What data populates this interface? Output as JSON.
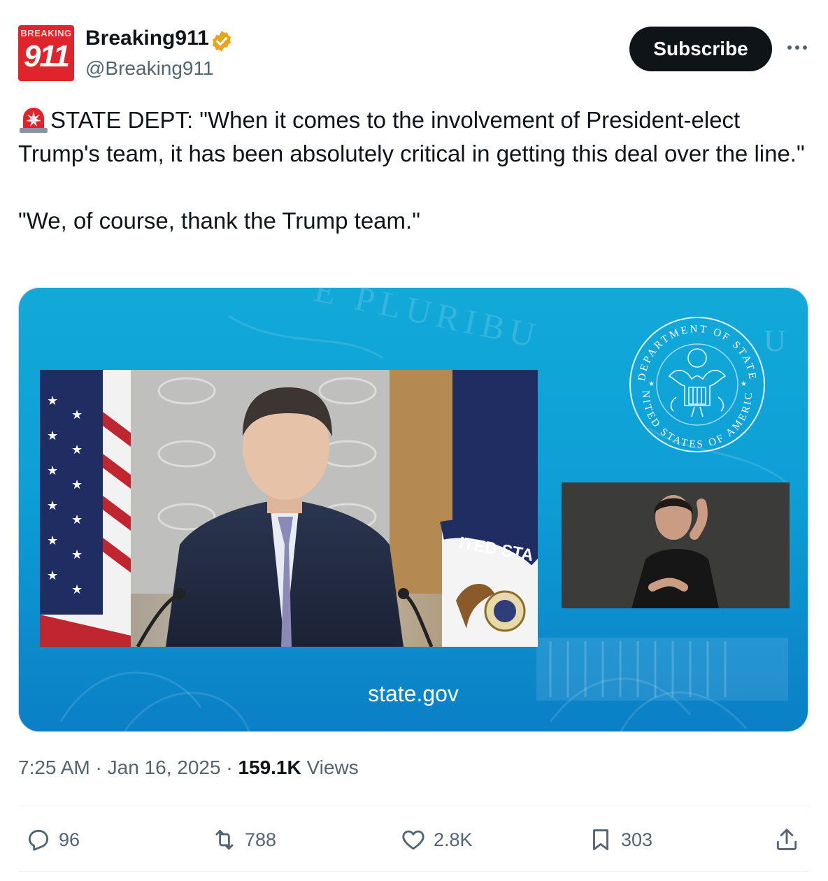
{
  "author": {
    "name": "Breaking911",
    "handle": "@Breaking911",
    "avatar_top_text": "BREAKING",
    "avatar_bottom_text": "911",
    "verified_color": "#e7a51c"
  },
  "header": {
    "subscribe_label": "Subscribe",
    "more_icon": "more-horizontal-icon"
  },
  "tweet": {
    "line1": "STATE DEPT: \"When it comes to the involvement of President-elect Trump's team, it has been absolutely critical in getting this deal over the line.\"",
    "line2": "\"We, of course, thank the Trump team.\"",
    "emoji": "siren-icon"
  },
  "media": {
    "caption": "state.gov",
    "seal_text_top": "DEPARTMENT OF STATE",
    "seal_text_bottom": "UNITED STATES OF AMERICA",
    "flag_text": "ITED STA",
    "watermark": "E PLURIBU",
    "corner_letter": "U"
  },
  "meta": {
    "time": "7:25 AM",
    "date": "Jan 16, 2025",
    "views_count": "159.1K",
    "views_label": "Views",
    "separator": "·"
  },
  "actions": {
    "replies": "96",
    "reposts": "788",
    "likes": "2.8K",
    "bookmarks": "303"
  },
  "colors": {
    "text": "#0f1419",
    "secondary": "#536471",
    "media_bg": "#0d9fd6",
    "brand_red": "#e0242b"
  }
}
